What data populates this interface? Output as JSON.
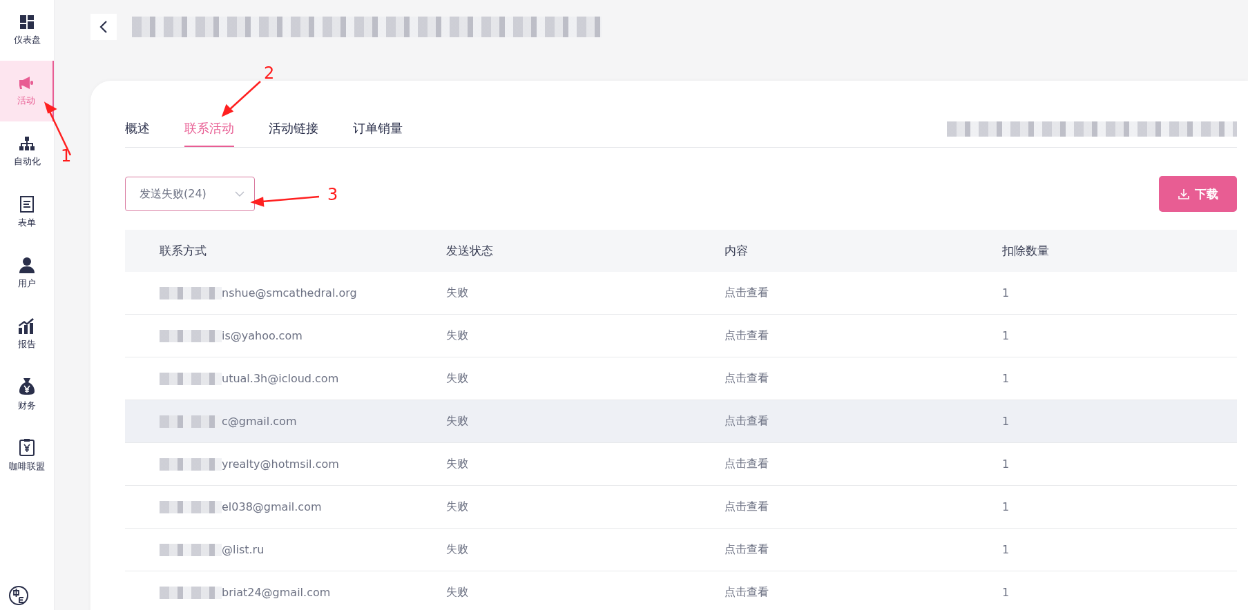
{
  "sidebar": {
    "items": [
      {
        "label": "仪表盘",
        "selected": false
      },
      {
        "label": "活动",
        "selected": true
      },
      {
        "label": "自动化",
        "selected": false
      },
      {
        "label": "表单",
        "selected": false
      },
      {
        "label": "用户",
        "selected": false
      },
      {
        "label": "报告",
        "selected": false
      },
      {
        "label": "财务",
        "selected": false
      },
      {
        "label": "咖啡联盟",
        "selected": false
      }
    ]
  },
  "tabs": [
    {
      "label": "概述",
      "selected": false
    },
    {
      "label": "联系活动",
      "selected": true
    },
    {
      "label": "活动链接",
      "selected": false
    },
    {
      "label": "订单销量",
      "selected": false
    }
  ],
  "filter": {
    "value": "发送失败(24)"
  },
  "download_button": {
    "label": "下载"
  },
  "table": {
    "columns": [
      "联系方式",
      "发送状态",
      "内容",
      "扣除数量"
    ],
    "rows": [
      {
        "contact": "nshue@smcathedral.org",
        "status": "失败",
        "content": "点击查看",
        "count": "1",
        "highlighted": false
      },
      {
        "contact": "is@yahoo.com",
        "status": "失败",
        "content": "点击查看",
        "count": "1",
        "highlighted": false
      },
      {
        "contact": "utual.3h@icloud.com",
        "status": "失败",
        "content": "点击查看",
        "count": "1",
        "highlighted": false
      },
      {
        "contact": "c@gmail.com",
        "status": "失败",
        "content": "点击查看",
        "count": "1",
        "highlighted": true
      },
      {
        "contact": "yrealty@hotmsil.com",
        "status": "失败",
        "content": "点击查看",
        "count": "1",
        "highlighted": false
      },
      {
        "contact": "el038@gmail.com",
        "status": "失败",
        "content": "点击查看",
        "count": "1",
        "highlighted": false
      },
      {
        "contact": "@list.ru",
        "status": "失败",
        "content": "点击查看",
        "count": "1",
        "highlighted": false
      },
      {
        "contact": "briat24@gmail.com",
        "status": "失败",
        "content": "点击查看",
        "count": "1",
        "highlighted": false
      }
    ]
  },
  "annotations": [
    {
      "label": "1"
    },
    {
      "label": "2"
    },
    {
      "label": "3"
    }
  ]
}
